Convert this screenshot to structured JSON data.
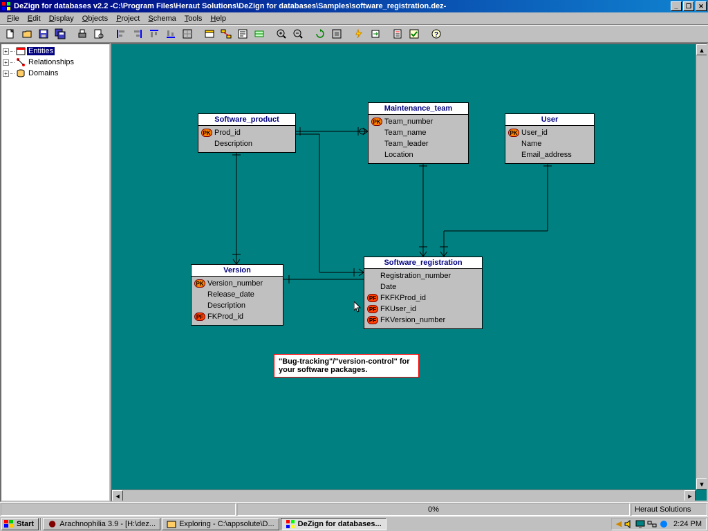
{
  "title": "DeZign for databases v2.2  -C:\\Program Files\\Heraut Solutions\\DeZign for databases\\Samples\\software_registration.dez-",
  "menu": [
    "File",
    "Edit",
    "Display",
    "Objects",
    "Project",
    "Schema",
    "Tools",
    "Help"
  ],
  "tree": {
    "entities": "Entities",
    "relationships": "Relationships",
    "domains": "Domains"
  },
  "entities": {
    "software_product": {
      "title": "Software_product",
      "attrs": [
        {
          "key": "PK",
          "name": "Prod_id"
        },
        {
          "key": "",
          "name": "Description"
        }
      ]
    },
    "maintenance_team": {
      "title": "Maintenance_team",
      "attrs": [
        {
          "key": "PK",
          "name": "Team_number"
        },
        {
          "key": "",
          "name": "Team_name"
        },
        {
          "key": "",
          "name": "Team_leader"
        },
        {
          "key": "",
          "name": "Location"
        }
      ]
    },
    "user": {
      "title": "User",
      "attrs": [
        {
          "key": "PK",
          "name": "User_id"
        },
        {
          "key": "",
          "name": "Name"
        },
        {
          "key": "",
          "name": "Email_address"
        }
      ]
    },
    "version": {
      "title": "Version",
      "attrs": [
        {
          "key": "PK",
          "name": "Version_number"
        },
        {
          "key": "",
          "name": "Release_date"
        },
        {
          "key": "",
          "name": "Description"
        },
        {
          "key": "PF",
          "name": "FKProd_id"
        }
      ]
    },
    "software_registration": {
      "title": "Software_registration",
      "attrs": [
        {
          "key": "",
          "name": "Registration_number"
        },
        {
          "key": "",
          "name": "Date"
        },
        {
          "key": "PF",
          "name": "FKFKProd_id"
        },
        {
          "key": "PF",
          "name": "FKUser_id"
        },
        {
          "key": "PF",
          "name": "FKVersion_number"
        }
      ]
    }
  },
  "note": "\"Bug-tracking\"/\"version-control\" for your software packages.",
  "status": {
    "progress": "0%",
    "company": "Heraut Solutions"
  },
  "taskbar": {
    "start": "Start",
    "tasks": [
      "Arachnophilia 3.9 - [H:\\dez...",
      "Exploring - C:\\appsolute\\D...",
      "DeZign for databases..."
    ],
    "clock": "2:24 PM"
  }
}
